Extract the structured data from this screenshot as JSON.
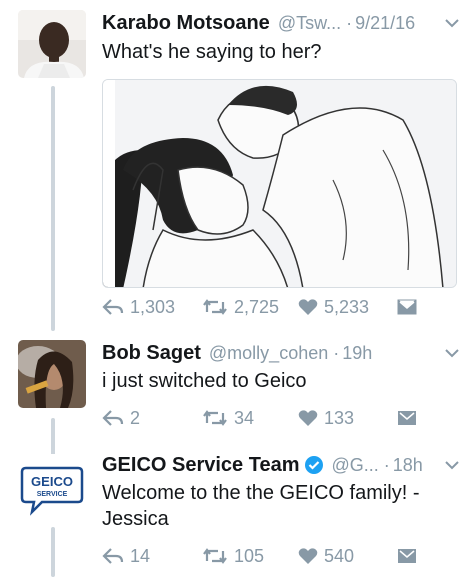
{
  "tweets": [
    {
      "name": "Karabo Motsoane",
      "handle": "@Tsw...",
      "dot": "·",
      "time": "9/21/16",
      "text": "What's he saying to her?",
      "reply_count": "1,303",
      "retweet_count": "2,725",
      "like_count": "5,233"
    },
    {
      "name": "Bob Saget",
      "handle": "@molly_cohen",
      "dot": "·",
      "time": "19h",
      "text": "i just switched to Geico",
      "reply_count": "2",
      "retweet_count": "34",
      "like_count": "133"
    },
    {
      "name": "GEICO Service Team",
      "handle": "@G...",
      "dot": "·",
      "time": "18h",
      "text_line1": "Welcome to the the GEICO family! -",
      "text_line2": "Jessica",
      "reply_count": "14",
      "retweet_count": "105",
      "like_count": "540",
      "verified": true
    }
  ],
  "geico_logo": {
    "word": "GEICO",
    "sub": "SERVICE"
  },
  "icons": {
    "reply": "reply-icon",
    "retweet": "retweet-icon",
    "like": "heart-icon",
    "dm": "direct-message-icon",
    "more": "chevron-down-icon",
    "verified": "verified-badge-icon"
  },
  "colors": {
    "icon_gray": "#8899a6",
    "verified_blue": "#1da1f2",
    "geico_blue": "#1b4a8c",
    "thread_line": "#cdd5dc"
  }
}
